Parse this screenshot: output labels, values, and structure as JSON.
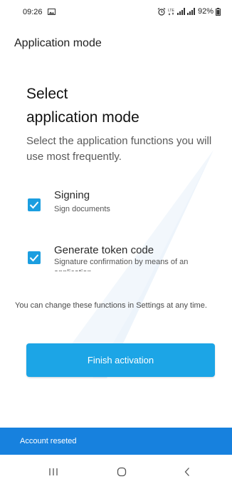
{
  "status_bar": {
    "time": "09:26",
    "battery": "92%",
    "network": "LTE"
  },
  "header": {
    "title": "Application mode"
  },
  "main": {
    "heading_line1": "Select",
    "heading_line2": "application mode",
    "subtitle": "Select the application functions you will use most frequently.",
    "options": [
      {
        "title": "Signing",
        "description": "Sign documents",
        "checked": true
      },
      {
        "title": "Generate token code",
        "description": "Signature confirmation by means of an application",
        "checked": true
      }
    ],
    "note": "You can change these functions in Settings at any time.",
    "finish_button": "Finish activation"
  },
  "snackbar": {
    "message": "Account reseted"
  },
  "nav": {
    "icons": [
      "recent-apps-icon",
      "home-icon",
      "back-icon"
    ]
  },
  "colors": {
    "accent": "#1ca5e6",
    "checkbox": "#1b9ee0",
    "snackbar": "#1781de"
  }
}
